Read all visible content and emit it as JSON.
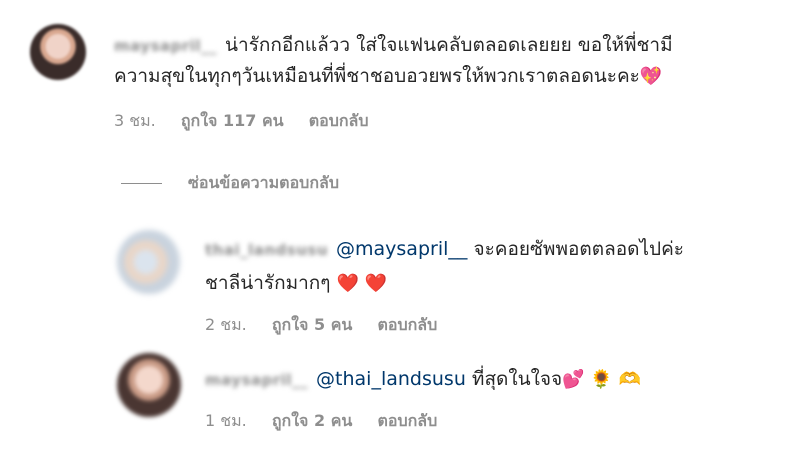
{
  "main_comment": {
    "username": "maysapril__",
    "text_line1": "น่ารักกอีกแล้วว ใส่ใจแฟนคลับตลอดเลยยย ขอให้พี่ชามี",
    "text_line2": "ความสุขในทุกๆวันเหมือนที่พี่ชาชอบอวยพรให้พวกเราตลอดนะคะ",
    "emoji": "💖",
    "time": "3 ชม.",
    "likes": "ถูกใจ 117 คน",
    "reply": "ตอบกลับ"
  },
  "hide_replies_label": "ซ่อนข้อความตอบกลับ",
  "replies": [
    {
      "username": "thai_landsusu",
      "mention": "@maysapril__",
      "text_line1": "จะคอยซัพพอตตลอดไปค่ะ",
      "text_line2": "ชาลีน่ารักมากๆ",
      "emoji": "❤️ ❤️",
      "time": "2 ชม.",
      "likes": "ถูกใจ 5 คน",
      "reply": "ตอบกลับ"
    },
    {
      "username": "maysapril__",
      "mention": "@thai_landsusu",
      "text": "ที่สุดในใจจ",
      "emoji": "💕 🌻 🫶",
      "time": "1 ชม.",
      "likes": "ถูกใจ 2 คน",
      "reply": "ตอบกลับ"
    }
  ]
}
